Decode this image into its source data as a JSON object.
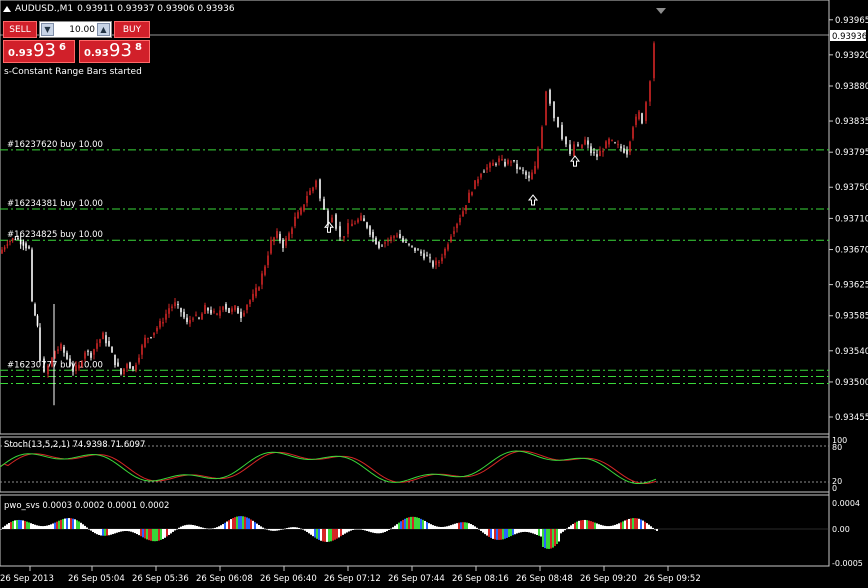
{
  "header": {
    "symbol_title": "AUDUSD.,M1",
    "ohlc": "0.93911 0.93937 0.93906 0.93936"
  },
  "trade_panel": {
    "sell_label": "SELL",
    "buy_label": "BUY",
    "volume": "10.00",
    "sell_price_small": "0.93",
    "sell_price_big": "93",
    "sell_price_sup": "6",
    "buy_price_small": "0.93",
    "buy_price_big": "93",
    "buy_price_sup": "8"
  },
  "status_message": "s-Constant Range Bars started",
  "order_lines": [
    {
      "label": "#16237620 buy 10.00",
      "price": 0.93798
    },
    {
      "label": "#16234381 buy 10.00",
      "price": 0.93722
    },
    {
      "label": "#16234825 buy 10.00",
      "price": 0.93682
    },
    {
      "label": "#16230777 buy 10.00",
      "price": 0.93515
    },
    {
      "label": "",
      "price": 0.93507
    },
    {
      "label": "",
      "price": 0.93498
    }
  ],
  "price_axis": {
    "ticks": [
      "0.93965",
      "0.93920",
      "0.93880",
      "0.93835",
      "0.93795",
      "0.93750",
      "0.93710",
      "0.93670",
      "0.93625",
      "0.93585",
      "0.93540",
      "0.93500",
      "0.93455"
    ],
    "current_price": "0.93936",
    "min": 0.93446,
    "max": 0.93975
  },
  "time_axis": [
    "26 Sep 2013",
    "26 Sep 05:04",
    "26 Sep 05:36",
    "26 Sep 06:08",
    "26 Sep 06:40",
    "26 Sep 07:12",
    "26 Sep 07:44",
    "26 Sep 08:16",
    "26 Sep 08:48",
    "26 Sep 09:20",
    "26 Sep 09:52"
  ],
  "stoch": {
    "label": "Stoch(13,5,2,1) 74.9398 71.6097",
    "levels": [
      "100",
      "80",
      "20",
      "0"
    ]
  },
  "pwo": {
    "label": "pwo_svs 0.0003 0.0002 0.0001 0.0002",
    "levels": [
      "0.0004",
      "0.00",
      "-0.0005"
    ]
  },
  "colors": {
    "background": "#000000",
    "bull": "#d42626",
    "bear": "#ffffff",
    "order_line": "#3ad83a",
    "stoch_main": "#3ad83a",
    "stoch_signal": "#d42626"
  },
  "chart_data": {
    "type": "candlestick",
    "x_range": [
      "26 Sep 2013",
      "26 Sep 09:52"
    ],
    "y_range": [
      0.93446,
      0.93975
    ],
    "close_path": [
      [
        0,
        0.93665
      ],
      [
        8,
        0.9368
      ],
      [
        16,
        0.93685
      ],
      [
        24,
        0.93678
      ],
      [
        30,
        0.9367
      ],
      [
        33,
        0.936
      ],
      [
        38,
        0.9357
      ],
      [
        42,
        0.9353
      ],
      [
        46,
        0.9351
      ],
      [
        50,
        0.9352
      ],
      [
        56,
        0.9354
      ],
      [
        62,
        0.93545
      ],
      [
        68,
        0.9353
      ],
      [
        74,
        0.93515
      ],
      [
        80,
        0.9352
      ],
      [
        86,
        0.9354
      ],
      [
        92,
        0.93535
      ],
      [
        98,
        0.9355
      ],
      [
        104,
        0.9356
      ],
      [
        110,
        0.93545
      ],
      [
        116,
        0.93525
      ],
      [
        122,
        0.9351
      ],
      [
        128,
        0.93525
      ],
      [
        134,
        0.93515
      ],
      [
        140,
        0.93535
      ],
      [
        146,
        0.93555
      ],
      [
        152,
        0.9356
      ],
      [
        158,
        0.9357
      ],
      [
        164,
        0.9358
      ],
      [
        170,
        0.93595
      ],
      [
        176,
        0.936
      ],
      [
        182,
        0.9359
      ],
      [
        188,
        0.93575
      ],
      [
        194,
        0.93585
      ],
      [
        200,
        0.9358
      ],
      [
        206,
        0.93595
      ],
      [
        212,
        0.9359
      ],
      [
        218,
        0.93585
      ],
      [
        224,
        0.936
      ],
      [
        230,
        0.9359
      ],
      [
        236,
        0.93595
      ],
      [
        242,
        0.93585
      ],
      [
        248,
        0.936
      ],
      [
        254,
        0.9361
      ],
      [
        260,
        0.93625
      ],
      [
        266,
        0.9365
      ],
      [
        272,
        0.9368
      ],
      [
        278,
        0.9369
      ],
      [
        284,
        0.93675
      ],
      [
        290,
        0.9369
      ],
      [
        296,
        0.9371
      ],
      [
        302,
        0.9372
      ],
      [
        308,
        0.9374
      ],
      [
        314,
        0.9375
      ],
      [
        318,
        0.9376
      ],
      [
        322,
        0.93735
      ],
      [
        326,
        0.9372
      ],
      [
        330,
        0.93705
      ],
      [
        334,
        0.93715
      ],
      [
        338,
        0.937
      ],
      [
        342,
        0.93685
      ],
      [
        346,
        0.9369
      ],
      [
        350,
        0.937
      ],
      [
        356,
        0.93705
      ],
      [
        362,
        0.9371
      ],
      [
        368,
        0.937
      ],
      [
        374,
        0.93685
      ],
      [
        380,
        0.93675
      ],
      [
        386,
        0.9368
      ],
      [
        392,
        0.93685
      ],
      [
        398,
        0.9369
      ],
      [
        404,
        0.9368
      ],
      [
        410,
        0.93675
      ],
      [
        416,
        0.9367
      ],
      [
        422,
        0.93665
      ],
      [
        428,
        0.9366
      ],
      [
        434,
        0.9365
      ],
      [
        440,
        0.93655
      ],
      [
        446,
        0.9367
      ],
      [
        452,
        0.9369
      ],
      [
        458,
        0.93705
      ],
      [
        464,
        0.9372
      ],
      [
        470,
        0.9374
      ],
      [
        476,
        0.93755
      ],
      [
        482,
        0.9377
      ],
      [
        488,
        0.93775
      ],
      [
        494,
        0.9378
      ],
      [
        500,
        0.93785
      ],
      [
        506,
        0.9378
      ],
      [
        512,
        0.93785
      ],
      [
        518,
        0.93775
      ],
      [
        524,
        0.9377
      ],
      [
        530,
        0.9376
      ],
      [
        536,
        0.93775
      ],
      [
        540,
        0.938
      ],
      [
        544,
        0.9383
      ],
      [
        548,
        0.93875
      ],
      [
        552,
        0.9386
      ],
      [
        556,
        0.9384
      ],
      [
        560,
        0.9383
      ],
      [
        564,
        0.93815
      ],
      [
        568,
        0.93805
      ],
      [
        572,
        0.9379
      ],
      [
        576,
        0.93805
      ],
      [
        580,
        0.938
      ],
      [
        586,
        0.9381
      ],
      [
        592,
        0.93795
      ],
      [
        598,
        0.9379
      ],
      [
        604,
        0.938
      ],
      [
        610,
        0.9381
      ],
      [
        616,
        0.93805
      ],
      [
        622,
        0.938
      ],
      [
        628,
        0.93795
      ],
      [
        634,
        0.9383
      ],
      [
        640,
        0.93845
      ],
      [
        644,
        0.93835
      ],
      [
        648,
        0.9386
      ],
      [
        652,
        0.9389
      ],
      [
        655,
        0.93936
      ]
    ],
    "stoch_levels": [
      80,
      20
    ],
    "pwo_zero": 0
  }
}
